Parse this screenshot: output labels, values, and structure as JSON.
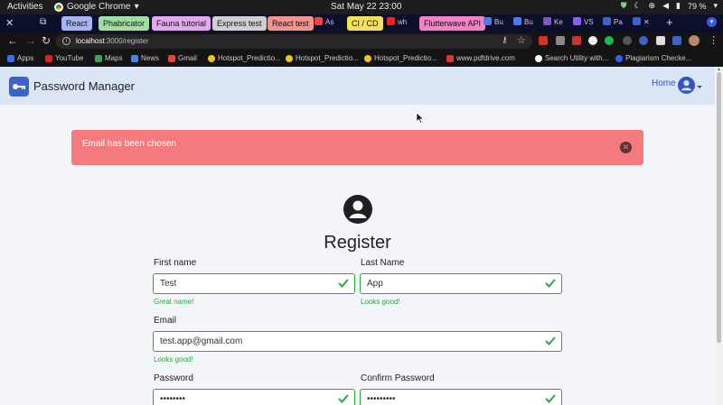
{
  "system_bar": {
    "activities": "Activities",
    "app_name": "Google Chrome",
    "clock": "Sat May 22  23:00",
    "battery": "79 %"
  },
  "tabs": [
    {
      "label": "React",
      "color": "#a6b4f7"
    },
    {
      "label": "Phabricator",
      "color": "#9ee0a2"
    },
    {
      "label": "Fauna tutorial",
      "color": "#e4a7f1"
    },
    {
      "label": "Express test",
      "color": "#cfcfcf"
    },
    {
      "label": "React test",
      "color": "#f6918c"
    },
    {
      "label": "As"
    },
    {
      "label": "CI / CD",
      "color": "#f6e05a"
    },
    {
      "label": "wh"
    },
    {
      "label": "Flutterwave API",
      "color": "#f781c7"
    },
    {
      "label": "Bu"
    },
    {
      "label": "Bu"
    },
    {
      "label": "Ke"
    },
    {
      "label": "VS"
    },
    {
      "label": "Pa"
    }
  ],
  "address": {
    "host": "localhost",
    "path": ":3000/register"
  },
  "bookmarks": [
    {
      "label": "Apps",
      "color": "#3a6ee8"
    },
    {
      "label": "YouTube",
      "color": "#e62117"
    },
    {
      "label": "Maps",
      "color": "#34a853"
    },
    {
      "label": "News",
      "color": "#4285f4"
    },
    {
      "label": "Gmail",
      "color": "#ea4335"
    },
    {
      "label": "Hotspot_Predictio...",
      "color": "#f0c419"
    },
    {
      "label": "Hotspot_Predictio...",
      "color": "#f0c419"
    },
    {
      "label": "Hotspot_Predictio...",
      "color": "#f0c419"
    },
    {
      "label": "www.pdfdrive.com",
      "color": "#d33"
    },
    {
      "label": "Search Utility with...",
      "color": "#ffffff"
    },
    {
      "label": "Plagiarism Checke...",
      "color": "#3d5afe"
    }
  ],
  "navbar": {
    "brand": "Password Manager",
    "home": "Home"
  },
  "alert": {
    "message": "Email has been chosen",
    "close_symbol": "✕"
  },
  "form": {
    "title": "Register",
    "first_name": {
      "label": "First name",
      "value": "Test",
      "hint": "Great name!"
    },
    "last_name": {
      "label": "Last Name",
      "value": "App",
      "hint": "Looks good!"
    },
    "email": {
      "label": "Email",
      "value": "test.app@gmail.com",
      "hint": "Looks good!"
    },
    "password": {
      "label": "Password",
      "value": "••••••••"
    },
    "confirm_password": {
      "label": "Confirm Password",
      "value": "•••••••••"
    }
  },
  "colors": {
    "valid": "#29a745",
    "alert_bg": "#f47a7e",
    "navbar_bg": "#dbe5f3",
    "brand_blue": "#3d63c9"
  }
}
